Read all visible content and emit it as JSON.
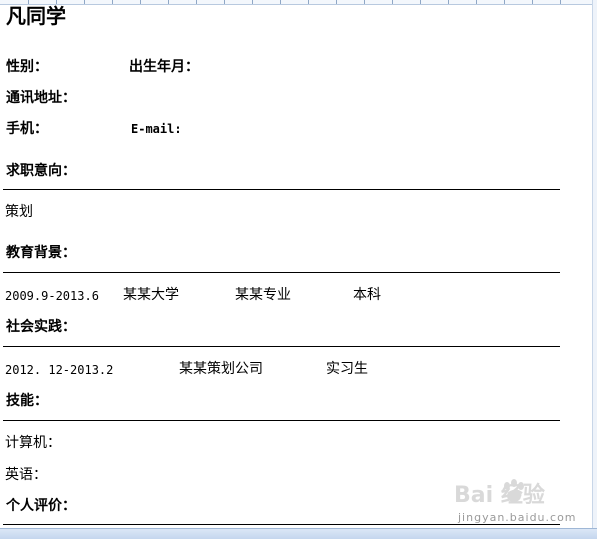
{
  "resume": {
    "name": "凡同学",
    "gender_label": "性别：",
    "birth_label": "出生年月：",
    "address_label": "通讯地址：",
    "phone_label": "手机：",
    "email_label": "E-mail:",
    "objective": {
      "heading": "求职意向：",
      "value": "策划"
    },
    "education": {
      "heading": "教育背景：",
      "period": "2009.9-2013.6",
      "school": "某某大学",
      "major": "某某专业",
      "degree": "本科"
    },
    "practice": {
      "heading": "社会实践：",
      "period": "2012. 12-2013.2",
      "company": "某某策划公司",
      "role": "实习生"
    },
    "skills": {
      "heading": "技能：",
      "computer": "计算机：",
      "english": "英语："
    },
    "self_eval": {
      "heading": "个人评价："
    }
  },
  "watermark": {
    "logo_text": "Bai 经验",
    "url": "jingyan.baidu.com"
  },
  "colors": {
    "text": "#000000",
    "chrome": "#c4d6ee"
  }
}
